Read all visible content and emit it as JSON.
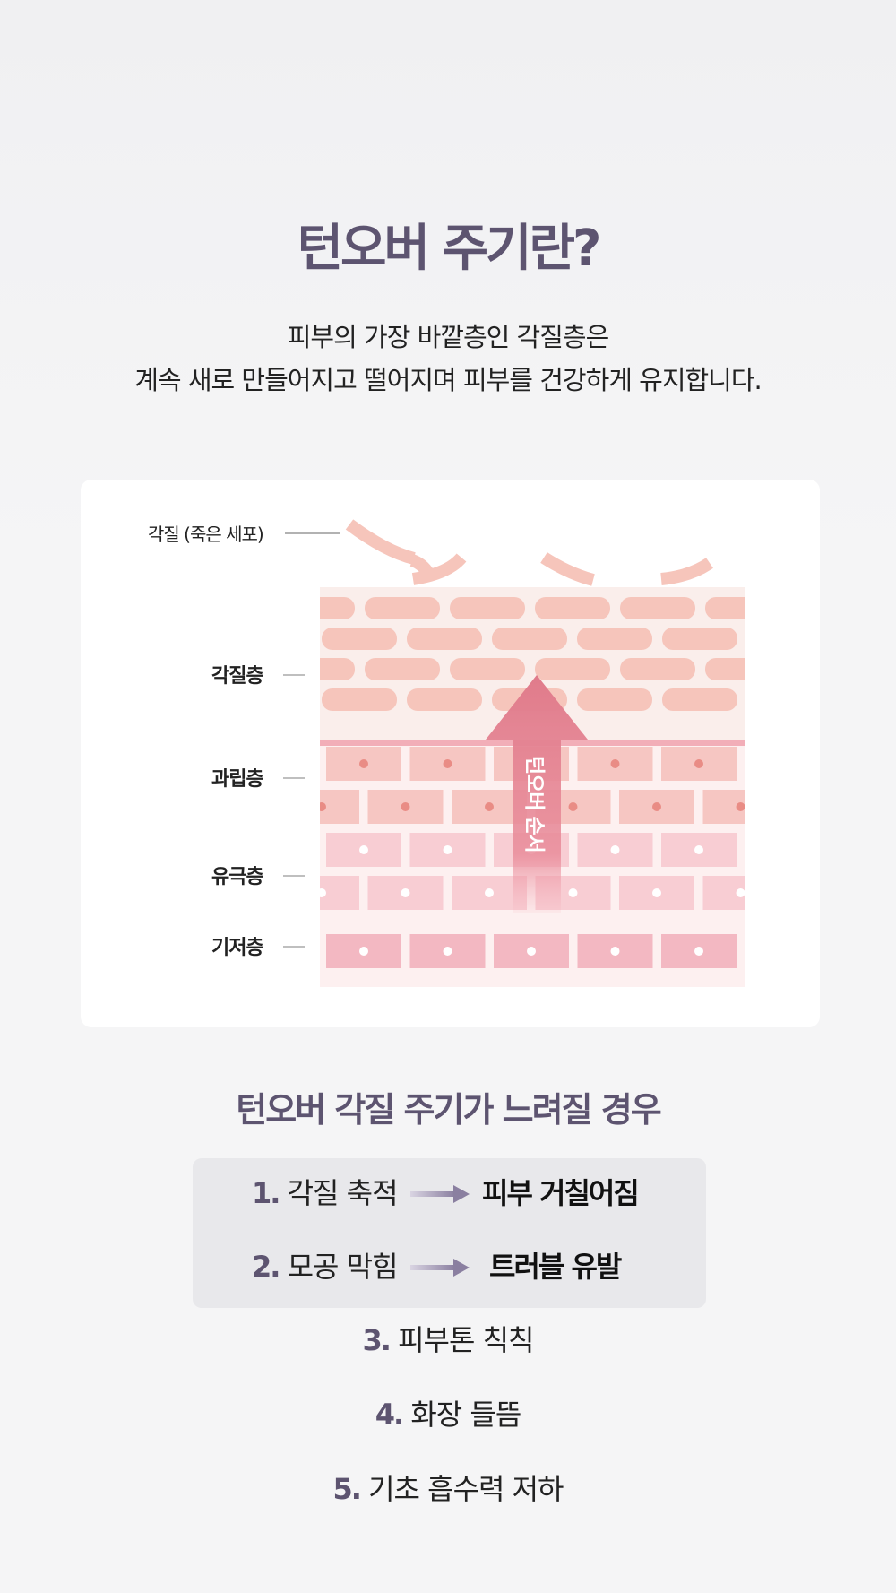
{
  "header": {
    "title": "턴오버 주기란?",
    "desc_line1": "피부의 가장 바깥층인 각질층은",
    "desc_line2": "계속 새로 만들어지고 떨어지며 피부를 건강하게 유지합니다."
  },
  "diagram": {
    "dead_cell_label": "각질 (죽은 세포)",
    "layers": [
      "각질층",
      "과립층",
      "유극층",
      "기저층"
    ],
    "arrow_label": "턴오버 순서",
    "colors": {
      "stratum": "#f6c5bb",
      "granular": "#f2aeb1",
      "spinous": "#f8cdd3",
      "basal": "#f3b8c2",
      "arrow": "#e07b8b"
    }
  },
  "slow_cycle": {
    "title": "턴오버 각질 주기가 느려질 경우",
    "highlighted": [
      {
        "num": "1.",
        "cause": "각질 축적",
        "result": "피부 거칠어짐"
      },
      {
        "num": "2.",
        "cause": "모공 막힘",
        "result": "트러블 유발"
      }
    ],
    "items": [
      {
        "num": "3.",
        "text": "피부톤 칙칙"
      },
      {
        "num": "4.",
        "text": "화장 들뜸"
      },
      {
        "num": "5.",
        "text": "기초 흡수력 저하"
      }
    ]
  }
}
